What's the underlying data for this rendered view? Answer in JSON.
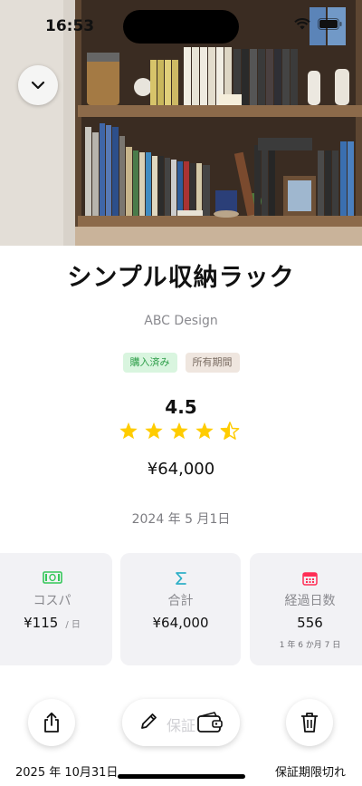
{
  "status_bar": {
    "time": "16:53"
  },
  "hero": {
    "image": "bookshelf-photo"
  },
  "item": {
    "name": "シンプル収納ラック",
    "brand": "ABC Design",
    "tags": [
      "購入済み",
      "所有期間"
    ],
    "rating": 4.5,
    "rating_text": "4.5",
    "price": "¥64,000",
    "purchase_date": "2024 年 5 月1日"
  },
  "stats": [
    {
      "icon": "money-icon",
      "label": "コスパ",
      "value": "¥115",
      "unit": "/ 日",
      "color": "#34c759"
    },
    {
      "icon": "sigma-icon",
      "label": "合計",
      "value": "¥64,000",
      "color": "#30b0c7"
    },
    {
      "icon": "calendar-icon",
      "label": "経過日数",
      "value": "556",
      "sub": "1 年 6 か月 7 日",
      "color": "#ff2d55"
    }
  ],
  "bottom_bar": {
    "pill_ghost_label": "保証",
    "footer_left": "2025 年 10月31日",
    "footer_right": "保証期限切れ"
  },
  "colors": {
    "star": "#ffcc00",
    "green_tag": "#2f9e4a"
  }
}
